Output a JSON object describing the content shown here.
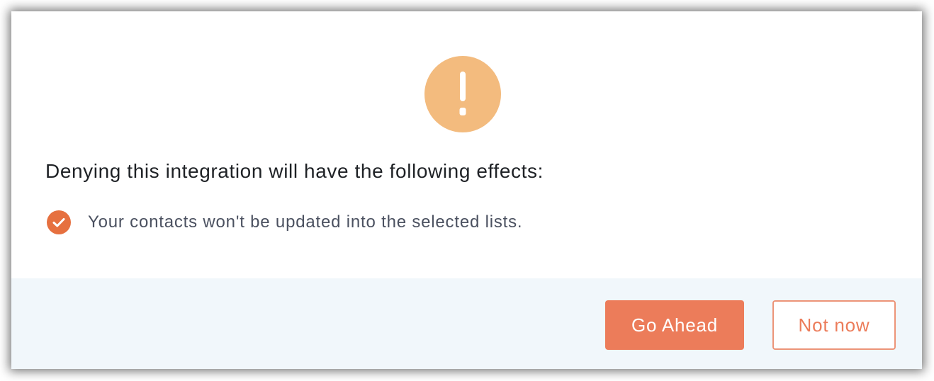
{
  "dialog": {
    "icon": "warning-exclamation-icon",
    "heading": "Denying this integration will have the following effects:",
    "effects": [
      {
        "icon": "check-circle-icon",
        "text": "Your contacts won't be updated into the selected lists."
      }
    ]
  },
  "footer": {
    "primary_label": "Go Ahead",
    "secondary_label": "Not now"
  },
  "colors": {
    "warning": "#f3bb7e",
    "accent": "#ec7c5a",
    "check": "#e6703f",
    "footer_bg": "#f1f7fb"
  }
}
